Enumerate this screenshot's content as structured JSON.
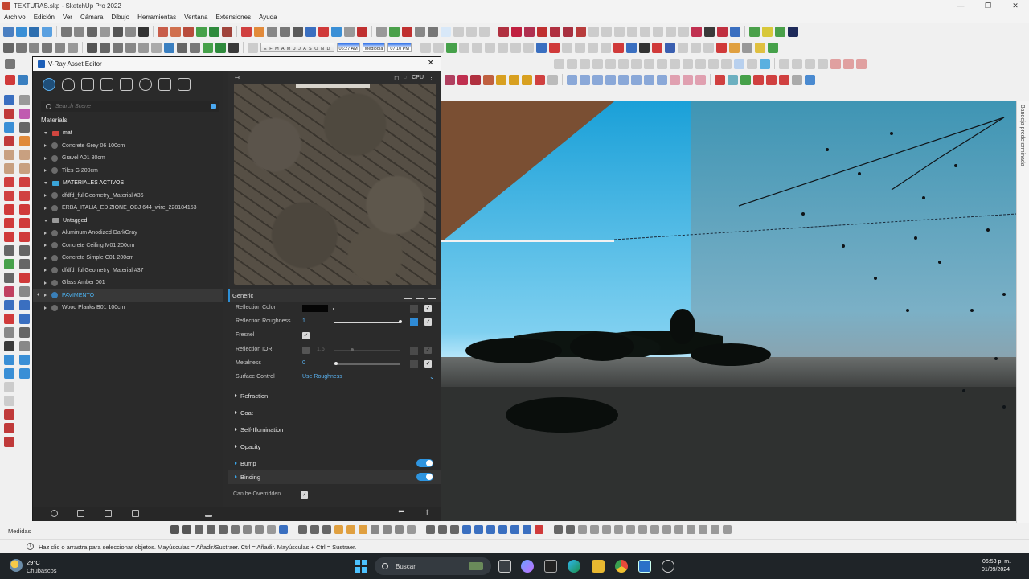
{
  "window": {
    "title": "TEXTURAS.skp - SketchUp Pro 2022",
    "controls": [
      "—",
      "❐",
      "✕"
    ]
  },
  "menu": [
    "Archivo",
    "Edición",
    "Ver",
    "Cámara",
    "Dibujo",
    "Herramientas",
    "Ventana",
    "Extensiones",
    "Ayuda"
  ],
  "shadow_settings": {
    "months": "E F M A M J J A S O N D",
    "time_start": "06:27 AM",
    "time_mid": "Mediodía",
    "time_end": "07:10 PM"
  },
  "vray": {
    "title": "V-Ray Asset Editor",
    "close": "✕",
    "tabs": [
      "materials-tab",
      "lights-tab",
      "geometry-tab",
      "layers-tab",
      "textures-tab",
      "settings-tab",
      "render-tab",
      "frame-buffer-tab"
    ],
    "search_placeholder": "Search Scene",
    "materials_header": "Materials",
    "materials": [
      {
        "label": "mat",
        "kind": "group",
        "folder_color": "#d0463f"
      },
      {
        "label": "Concrete Grey 06 100cm",
        "kind": "item"
      },
      {
        "label": "Gravel A01 80cm",
        "kind": "item"
      },
      {
        "label": "Tiles G 200cm",
        "kind": "item"
      },
      {
        "label": "MATERIALES ACTIVOS",
        "kind": "group",
        "folder_color": "#3aa4d8"
      },
      {
        "label": "dfdfd_fullGeometry_Material #36",
        "kind": "item"
      },
      {
        "label": "ERBA_ITALIA_EDIZIONE_OBJ 644_wire_228184153",
        "kind": "item"
      },
      {
        "label": "Untagged",
        "kind": "group",
        "folder_color": "#999999"
      },
      {
        "label": "Aluminum Anodized DarkGray",
        "kind": "item"
      },
      {
        "label": "Concrete Ceiling M01 200cm",
        "kind": "item"
      },
      {
        "label": "Concrete Simple C01 200cm",
        "kind": "item"
      },
      {
        "label": "dfdfd_fullGeometry_Material #37",
        "kind": "item"
      },
      {
        "label": "Glass Amber 001",
        "kind": "item"
      },
      {
        "label": "PAVIMENTO",
        "kind": "selected"
      },
      {
        "label": "Wood Planks B01 100cm",
        "kind": "item"
      }
    ],
    "preview": {
      "render_mode": "CPU"
    },
    "properties": {
      "section": "Generic",
      "reflection_color_label": "Reflection Color",
      "reflection_roughness_label": "Reflection Roughness",
      "reflection_roughness_value": "1",
      "fresnel_label": "Fresnel",
      "fresnel_checked": true,
      "reflection_ior_label": "Reflection IOR",
      "reflection_ior_value": "1.6",
      "metalness_label": "Metalness",
      "metalness_value": "0",
      "surface_control_label": "Surface Control",
      "surface_control_value": "Use Roughness"
    },
    "sections": [
      {
        "label": "Refraction",
        "toggle": false
      },
      {
        "label": "Coat",
        "toggle": false
      },
      {
        "label": "Self-Illumination",
        "toggle": false
      },
      {
        "label": "Opacity",
        "toggle": false
      },
      {
        "label": "Bump",
        "toggle": true
      },
      {
        "label": "Binding",
        "toggle": true
      }
    ],
    "can_be_overridden_label": "Can be Overridden",
    "can_be_overridden_checked": true
  },
  "tray_label": "Bandeja predeterminada",
  "measurements_label": "Medidas",
  "status_message": "Haz clic o arrastra para seleccionar objetos. Mayúsculas = Añadir/Sustraer. Ctrl = Añadir. Mayúsculas + Ctrl = Sustraer.",
  "taskbar": {
    "temperature": "29°C",
    "weather": "Chubascos",
    "search": "Buscar",
    "time": "06:53 p. m.",
    "date": "01/09/2024"
  },
  "colors": {
    "accent": "#2e95e0",
    "selected_text": "#4cb2f0",
    "panel_bg": "#2b2b2b"
  }
}
